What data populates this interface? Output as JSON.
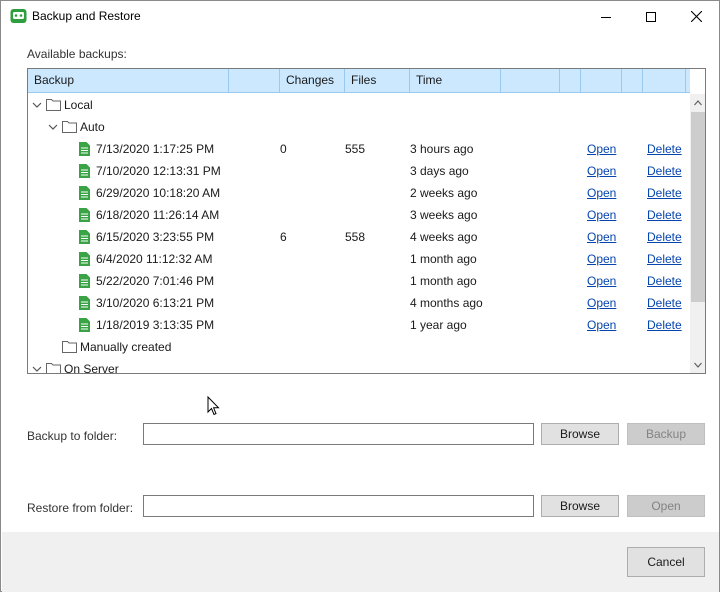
{
  "window": {
    "title": "Backup and Restore",
    "icon": "robot-icon",
    "controls": [
      "minimize-icon",
      "maximize-icon",
      "close-icon"
    ]
  },
  "available_label": "Available backups:",
  "table": {
    "columns": [
      "Backup",
      "Changes",
      "Files",
      "Time"
    ],
    "groups": {
      "local": "Local",
      "auto": "Auto",
      "manual": "Manually created",
      "server": "On Server"
    },
    "rows": [
      {
        "name": "7/13/2020 1:17:25 PM",
        "changes": "0",
        "files": "555",
        "time": "3 hours ago",
        "open": "Open",
        "delete": "Delete"
      },
      {
        "name": "7/10/2020 12:13:31 PM",
        "changes": "",
        "files": "",
        "time": "3 days ago",
        "open": "Open",
        "delete": "Delete"
      },
      {
        "name": "6/29/2020 10:18:20 AM",
        "changes": "",
        "files": "",
        "time": "2 weeks ago",
        "open": "Open",
        "delete": "Delete"
      },
      {
        "name": "6/18/2020 11:26:14 AM",
        "changes": "",
        "files": "",
        "time": "3 weeks ago",
        "open": "Open",
        "delete": "Delete"
      },
      {
        "name": "6/15/2020 3:23:55 PM",
        "changes": "6",
        "files": "558",
        "time": "4 weeks ago",
        "open": "Open",
        "delete": "Delete"
      },
      {
        "name": "6/4/2020 11:12:32 AM",
        "changes": "",
        "files": "",
        "time": "1 month ago",
        "open": "Open",
        "delete": "Delete"
      },
      {
        "name": "5/22/2020 7:01:46 PM",
        "changes": "",
        "files": "",
        "time": "1 month ago",
        "open": "Open",
        "delete": "Delete"
      },
      {
        "name": "3/10/2020 6:13:21 PM",
        "changes": "",
        "files": "",
        "time": "4 months ago",
        "open": "Open",
        "delete": "Delete"
      },
      {
        "name": "1/18/2019 3:13:35 PM",
        "changes": "",
        "files": "",
        "time": "1 year ago",
        "open": "Open",
        "delete": "Delete"
      }
    ]
  },
  "backup_to": {
    "label": "Backup to folder:",
    "value": "",
    "browse": "Browse",
    "action": "Backup"
  },
  "restore_from": {
    "label": "Restore from folder:",
    "value": "",
    "browse": "Browse",
    "action": "Open"
  },
  "footer": {
    "cancel": "Cancel"
  },
  "colors": {
    "header_bg": "#cce8ff",
    "doc_icon": "#3aa346",
    "link": "#0645ad"
  }
}
